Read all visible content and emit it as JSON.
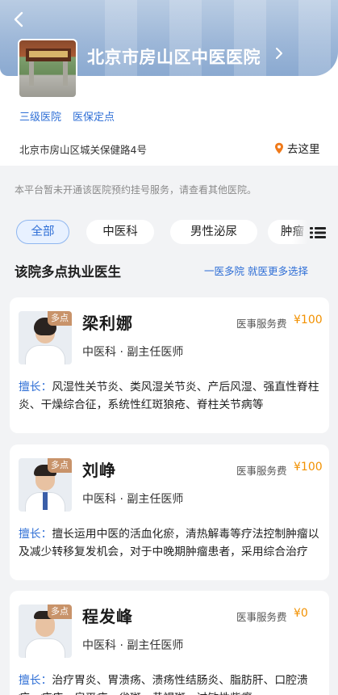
{
  "hospital": {
    "name": "北京市房山区中医医院",
    "tags": [
      "三级医院",
      "医保定点"
    ],
    "address": "北京市房山区城关保健路4号",
    "goto_label": "去这里"
  },
  "notice": "本平台暂未开通该医院预约挂号服务，请查看其他医院。",
  "filters": [
    "全部",
    "中医科",
    "男性泌尿",
    "肿瘤"
  ],
  "section": {
    "title": "该院多点执业医生",
    "link": "一医多院 就医更多选择"
  },
  "badge_label": "多点",
  "fee_label": "医事服务费",
  "specialty_label": "擅长：",
  "doctors": [
    {
      "name": "梁利娜",
      "title": "中医科 · 副主任医师",
      "fee": "¥100",
      "specialty": "风湿性关节炎、类风湿关节炎、产后风湿、强直性脊柱炎、干燥综合征，系统性红斑狼疮、脊柱关节病等"
    },
    {
      "name": "刘峥",
      "title": "中医科 · 副主任医师",
      "fee": "¥100",
      "specialty": "擅长运用中医的活血化瘀，清热解毒等疗法控制肿瘤以及减少转移复发机会，对于中晚期肿瘤患者，采用综合治疗"
    },
    {
      "name": "程发峰",
      "title": "中医科 · 副主任医师",
      "fee": "¥0",
      "specialty": "治疗胃炎、胃溃疡、溃疡性结肠炎、脂肪肝、口腔溃疡、痤疮、扁平疣、雀斑、黄褐斑、过敏性紫癜"
    }
  ],
  "colors": {
    "accent": "#2f6fd6",
    "fee": "#f29100",
    "badge": "#c8936a"
  },
  "icons": {
    "back": "back-arrow-icon",
    "location": "location-pin-icon",
    "list": "list-menu-icon"
  }
}
